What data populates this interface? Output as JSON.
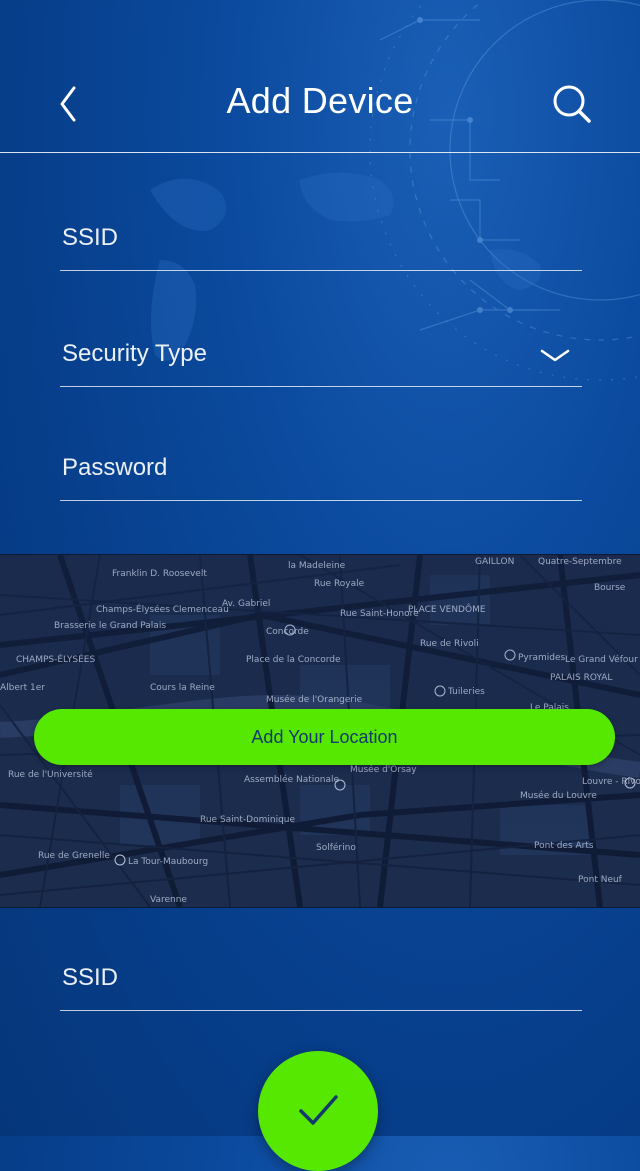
{
  "header": {
    "title": "Add Device",
    "back_icon": "chevron-left-icon",
    "search_icon": "search-icon"
  },
  "form": {
    "ssid_placeholder": "SSID",
    "security_type_placeholder": "Security Type",
    "password_placeholder": "Password",
    "ssid2_placeholder": "SSID",
    "security_dropdown_icon": "chevron-down-icon"
  },
  "map": {
    "labels": [
      "la Madeleine",
      "GAILLON",
      "Quatre-Septembre",
      "Franklin D. Roosevelt",
      "Champs-Élysées Clemenceau",
      "Concorde",
      "PLACE VENDÔME",
      "Pyramides",
      "Brasserie le Grand Palais",
      "CHAMPS-ÉLYSÉES",
      "Place de la Concorde",
      "Le Grand Véfour",
      "PALAIS ROYAL",
      "Albert 1er",
      "Cours la Reine",
      "Musée de l'Orangerie",
      "Tuileries",
      "Le Palais",
      "Assemblée Nationale",
      "Musée d'Orsay",
      "Louvre - Rivoli",
      "Rue de l'Université",
      "Rue Saint-Dominique",
      "Solférino",
      "Musée du Louvre",
      "Pont des Arts",
      "Rue de Grenelle",
      "La Tour-Maubourg",
      "Pont Neuf",
      "Varenne",
      "Bourse",
      "Rue Royale",
      "Rue Saint-Honoré",
      "Av. Gabriel",
      "Rue de Rivoli"
    ],
    "button_label": "Add Your Location"
  },
  "confirm": {
    "icon": "checkmark-icon"
  },
  "colors": {
    "accent_green": "#56e800",
    "background_blue": "#0b4a9e",
    "map_dark": "#1a2a4a"
  }
}
